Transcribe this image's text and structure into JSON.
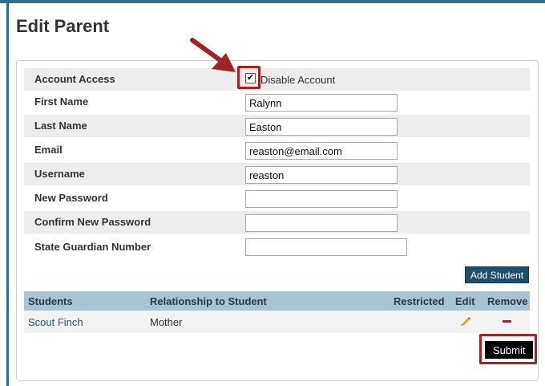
{
  "page": {
    "title": "Edit Parent"
  },
  "form": {
    "account_access": {
      "label": "Account Access",
      "checkbox_label": "Disable Account",
      "checked": true
    },
    "first_name": {
      "label": "First Name",
      "value": "Ralynn"
    },
    "last_name": {
      "label": "Last Name",
      "value": "Easton"
    },
    "email": {
      "label": "Email",
      "value": "reaston@email.com"
    },
    "username": {
      "label": "Username",
      "value": "reaston"
    },
    "new_password": {
      "label": "New Password",
      "value": ""
    },
    "confirm_password": {
      "label": "Confirm New Password",
      "value": ""
    },
    "state_guardian_number": {
      "label": "State Guardian Number",
      "value": ""
    }
  },
  "buttons": {
    "add_student": "Add Student",
    "submit": "Submit"
  },
  "students_table": {
    "headers": {
      "students": "Students",
      "relationship": "Relationship to Student",
      "restricted": "Restricted",
      "edit": "Edit",
      "remove": "Remove"
    },
    "rows": [
      {
        "student": "Scout Finch",
        "relationship": "Mother",
        "restricted": ""
      }
    ]
  },
  "colors": {
    "accent": "#2b6f8e",
    "highlight": "#a02424",
    "table_header": "#a6c4d2",
    "button": "#1d4f6e"
  },
  "icons": {
    "edit": "pencil-icon",
    "remove": "minus-icon",
    "annotation": "arrow-icon"
  }
}
